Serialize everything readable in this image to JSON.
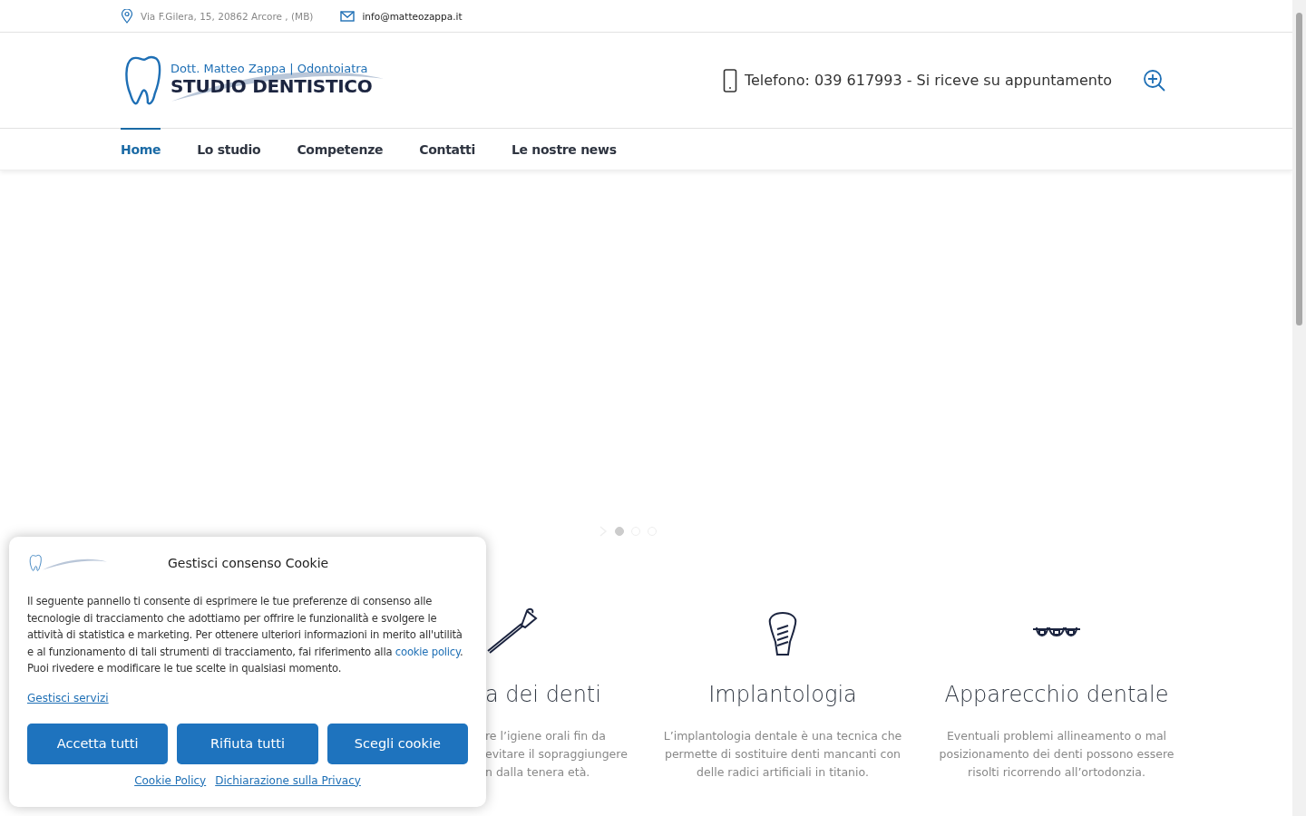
{
  "topbar": {
    "address": "Via F.Gilera, 15, 20862 Arcore , (MB)",
    "email": "info@matteozappa.it"
  },
  "header": {
    "logo": {
      "line1": "Dott. Matteo Zappa | Odontoiatra",
      "line2": "STUDIO DENTISTICO"
    },
    "phone": "Telefono: 039 617993 - Si riceve su appuntamento"
  },
  "nav": [
    {
      "label": "Home",
      "selected": true
    },
    {
      "label": "Lo studio",
      "selected": false
    },
    {
      "label": "Competenze",
      "selected": false
    },
    {
      "label": "Contatti",
      "selected": false
    },
    {
      "label": "Le nostre news",
      "selected": false
    }
  ],
  "slider": {
    "dots": [
      {
        "selected": true
      },
      {
        "selected": false
      },
      {
        "selected": false
      }
    ]
  },
  "services": [
    {
      "kind": "partial",
      "title": "a dei denti",
      "lines": [
        "re l’igiene orali fin da",
        "evitare il sopraggiungere",
        "n dalla tenera età."
      ]
    },
    {
      "kind": "implant",
      "title": "Implantologia",
      "lines": [
        "L’implantologia dentale è una tecnica che",
        "permette di sostituire denti mancanti con",
        "delle radici artificiali in titanio."
      ]
    },
    {
      "kind": "braces",
      "title": "Apparecchio dentale",
      "lines": [
        "Eventuali problemi allineamento o mal",
        "posizionamento dei denti possono essere",
        "risolti ricorrendo all’ortodonzia."
      ]
    }
  ],
  "cookie": {
    "title": "Gestisci consenso Cookie",
    "text": "Il seguente pannello ti consente di esprimere le tue preferenze di consenso alle tecnologie di tracciamento che adottiamo per offrire le funzionalità e svolgere le attività di statistica e marketing. Per ottenere ulteriori informazioni in merito all'utilità e al funzionamento di tali strumenti di tracciamento, fai riferimento alla",
    "link": "cookie policy",
    "text_end": ".",
    "text2": "Puoi rivedere e modificare le tue scelte in qualsiasi momento.",
    "manage": "Gestisci servizi",
    "buttons": [
      "Accetta tutti",
      "Rifiuta tutti",
      "Scegli cookie"
    ],
    "footer_links": [
      "Cookie Policy",
      "Dichiarazione sulla Privacy"
    ]
  }
}
